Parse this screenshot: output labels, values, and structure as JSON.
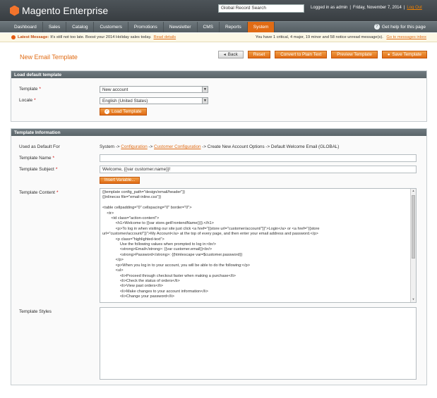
{
  "header": {
    "brand": "Magento",
    "edition": "Enterprise",
    "search_placeholder": "Global Record Search",
    "logged_in": "Logged in as admin",
    "date": "Friday, November 7, 2014",
    "logout": "Log Out"
  },
  "nav": {
    "items": [
      {
        "label": "Dashboard"
      },
      {
        "label": "Sales"
      },
      {
        "label": "Catalog"
      },
      {
        "label": "Customers"
      },
      {
        "label": "Promotions"
      },
      {
        "label": "Newsletter"
      },
      {
        "label": "CMS"
      },
      {
        "label": "Reports"
      },
      {
        "label": "System"
      }
    ],
    "active": "System",
    "help": "Get help for this page"
  },
  "message": {
    "label": "Latest Message:",
    "text": "It's still not too late. Boost your 2014 Holiday sales today.",
    "link": "Read details",
    "right_text": "You have 1 critical, 4 major, 19 minor and 58 notice unread message(s).",
    "right_link": "Go to messages inbox"
  },
  "page": {
    "title": "New Email Template",
    "buttons": {
      "back": "Back",
      "reset": "Reset",
      "convert": "Convert to Plain Text",
      "preview": "Preview Template",
      "save": "Save Template"
    }
  },
  "load_section": {
    "title": "Load default template",
    "template_label": "Template",
    "template_value": "New account",
    "locale_label": "Locale",
    "locale_value": "English (United States)",
    "load_button": "Load Template"
  },
  "info_section": {
    "title": "Template Information",
    "used_as_default_label": "Used as Default For",
    "used_prefix": "System ->",
    "used_link1": "Configuration",
    "used_mid": "->",
    "used_link2": "Customer Configuration",
    "used_suffix": "-> Create New Account Options -> Default Welcome Email  (GLOBAL)",
    "name_label": "Template Name",
    "subject_label": "Template Subject",
    "subject_value": "Welcome, {{var customer.name}}!",
    "insert_button": "Insert Variable...",
    "content_label": "Template Content",
    "content_lines": [
      "{{template config_path=\"design/email/header\"}}",
      "{{inlinecss file=\"email-inline.css\"}}",
      "",
      "<table cellpadding=\"0\" cellspacing=\"0\" border=\"0\">",
      "    <tr>",
      "        <td class=\"action-content\">",
      "            <h1>Welcome to {{var store.getFrontendName()}}.</h1>",
      "            <p>To log in when visiting our site just click <a href=\"{{store url=\"customer/account/\"}}\">Login</a> or <a href=\"{{store",
      "url=\"customer/account/\"}}\">My Account</a> at the top of every page, and then enter your email address and password.</p>",
      "            <p class=\"highlighted-text\">",
      "                Use the following values when prompted to log in:<br/>",
      "                <strong>Email</strong>: {{var customer.email}}<br/>",
      "                <strong>Password</strong>: {{htmlescape var=$customer.password}}",
      "            </p>",
      "            <p>When you log in to your account, you will be able to do the following:</p>",
      "            <ul>",
      "                <li>Proceed through checkout faster when making a purchase</li>",
      "                <li>Check the status of orders</li>",
      "                <li>View past orders</li>",
      "                <li>Make changes to your account information</li>",
      "                <li>Change your password</li>"
    ],
    "styles_label": "Template Styles"
  }
}
